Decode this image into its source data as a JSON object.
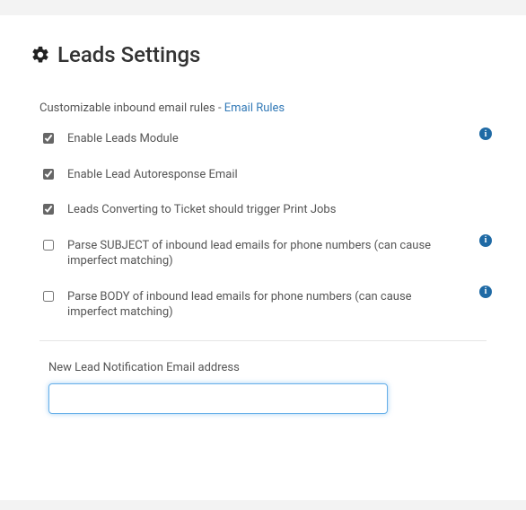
{
  "header": {
    "title": "Leads Settings",
    "icon": "gear-icon"
  },
  "intro": {
    "text_prefix": "Customizable inbound email rules - ",
    "link_text": "Email Rules"
  },
  "settings": [
    {
      "id": "enable-leads",
      "label": "Enable Leads Module",
      "checked": true,
      "info": true
    },
    {
      "id": "enable-autoresponse",
      "label": "Enable Lead Autoresponse Email",
      "checked": true,
      "info": false
    },
    {
      "id": "trigger-print-jobs",
      "label": "Leads Converting to Ticket should trigger Print Jobs",
      "checked": true,
      "info": false
    },
    {
      "id": "parse-subject",
      "label": "Parse SUBJECT of inbound lead emails for phone numbers (can cause imperfect matching)",
      "checked": false,
      "info": true
    },
    {
      "id": "parse-body",
      "label": "Parse BODY of inbound lead emails for phone numbers (can cause imperfect matching)",
      "checked": false,
      "info": true
    }
  ],
  "notification_email": {
    "label": "New Lead Notification Email address",
    "value": "",
    "placeholder": ""
  },
  "info_glyph": "i"
}
